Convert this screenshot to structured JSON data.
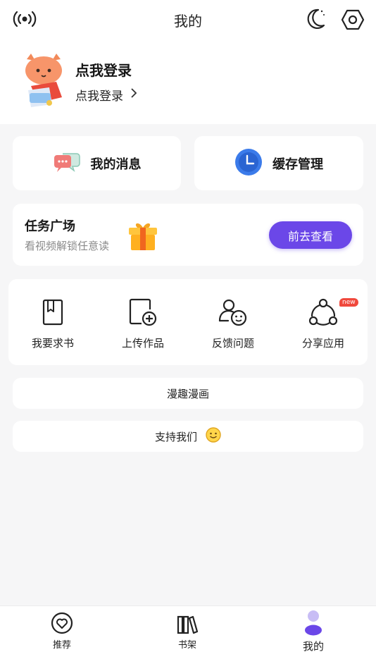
{
  "topbar": {
    "title": "我的",
    "left_icon": "broadcast-icon",
    "right_icons": [
      "moon-icon",
      "settings-hex-icon"
    ]
  },
  "profile": {
    "title": "点我登录",
    "subtitle": "点我登录",
    "subtitle_icon": "chevron-right-icon",
    "avatar": "cat-mascot-avatar"
  },
  "quick": {
    "messages_label": "我的消息",
    "cache_label": "缓存管理"
  },
  "task": {
    "title": "任务广场",
    "subtitle": "看视频解锁任意读",
    "button": "前去查看"
  },
  "tools": [
    {
      "label": "我要求书",
      "icon": "book-icon"
    },
    {
      "label": "上传作品",
      "icon": "upload-doc-icon"
    },
    {
      "label": "反馈问题",
      "icon": "feedback-icon"
    },
    {
      "label": "分享应用",
      "icon": "share-icon"
    }
  ],
  "tools_badge": "new",
  "links": {
    "manqu": "漫趣漫画",
    "support": "支持我们"
  },
  "tabbar": [
    {
      "label": "推荐",
      "icon": "heart-circle-icon"
    },
    {
      "label": "书架",
      "icon": "bookshelf-icon"
    },
    {
      "label": "我的",
      "icon": "person-icon",
      "active": true
    }
  ],
  "colors": {
    "accent": "#6b47e8",
    "background": "#f6f6f7",
    "badge": "#f0483c",
    "cache_icon": "#3b7bea"
  }
}
